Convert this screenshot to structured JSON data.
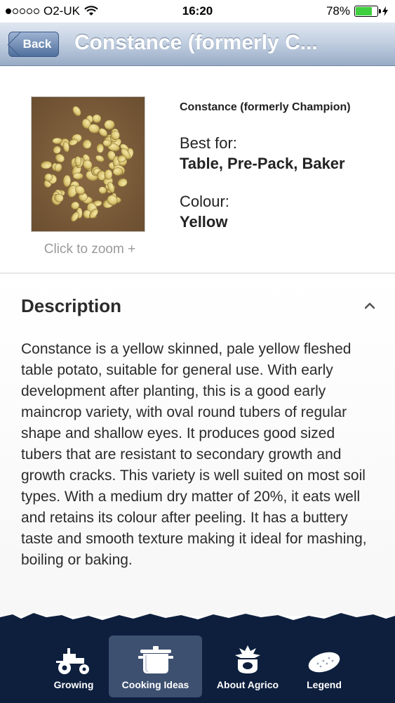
{
  "status_bar": {
    "carrier": "O2-UK",
    "time": "16:20",
    "battery": "78%",
    "battery_level": 0.78
  },
  "nav": {
    "back_label": "Back",
    "title": "Constance (formerly C..."
  },
  "product": {
    "name": "Constance (formerly Champion)",
    "zoom_label": "Click to zoom +",
    "best_for_label": "Best for:",
    "best_for_value": "Table, Pre-Pack, Baker",
    "colour_label": "Colour:",
    "colour_value": "Yellow"
  },
  "description": {
    "title": "Description",
    "body": "Constance is a yellow skinned, pale yellow fleshed table potato, suitable for general use. With early development after planting, this is a good early maincrop variety, with oval round tubers of regular shape and shallow eyes. It produces good sized tubers that are resistant to secondary growth and growth cracks. This variety is well suited on most soil types. With a medium dry matter of 20%, it eats well and retains its colour after peeling. It has a buttery taste and smooth texture making it ideal for mashing, boiling or baking."
  },
  "tabs": [
    {
      "label": "Growing",
      "icon": "tractor-icon",
      "active": false
    },
    {
      "label": "Cooking Ideas",
      "icon": "cooking-pot-icon",
      "active": true
    },
    {
      "label": "About Agrico",
      "icon": "agrico-logo-icon",
      "active": false
    },
    {
      "label": "Legend",
      "icon": "potato-icon",
      "active": false
    }
  ],
  "colors": {
    "tab_bar_bg": "#0d1f3d",
    "nav_title": "#ffffff",
    "battery_fill": "#3fcf3f"
  }
}
